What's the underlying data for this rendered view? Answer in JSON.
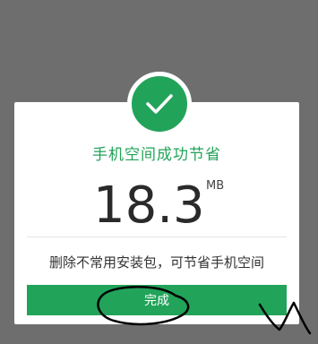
{
  "dialog": {
    "title": "手机空间成功节省",
    "amount": "18.3",
    "unit": "MB",
    "tip": "删除不常用安装包，可节省手机空间",
    "done_label": "完成"
  },
  "icons": {
    "success": "check-icon"
  },
  "colors": {
    "accent": "#22a35a",
    "overlay": "#6e6e6e"
  }
}
